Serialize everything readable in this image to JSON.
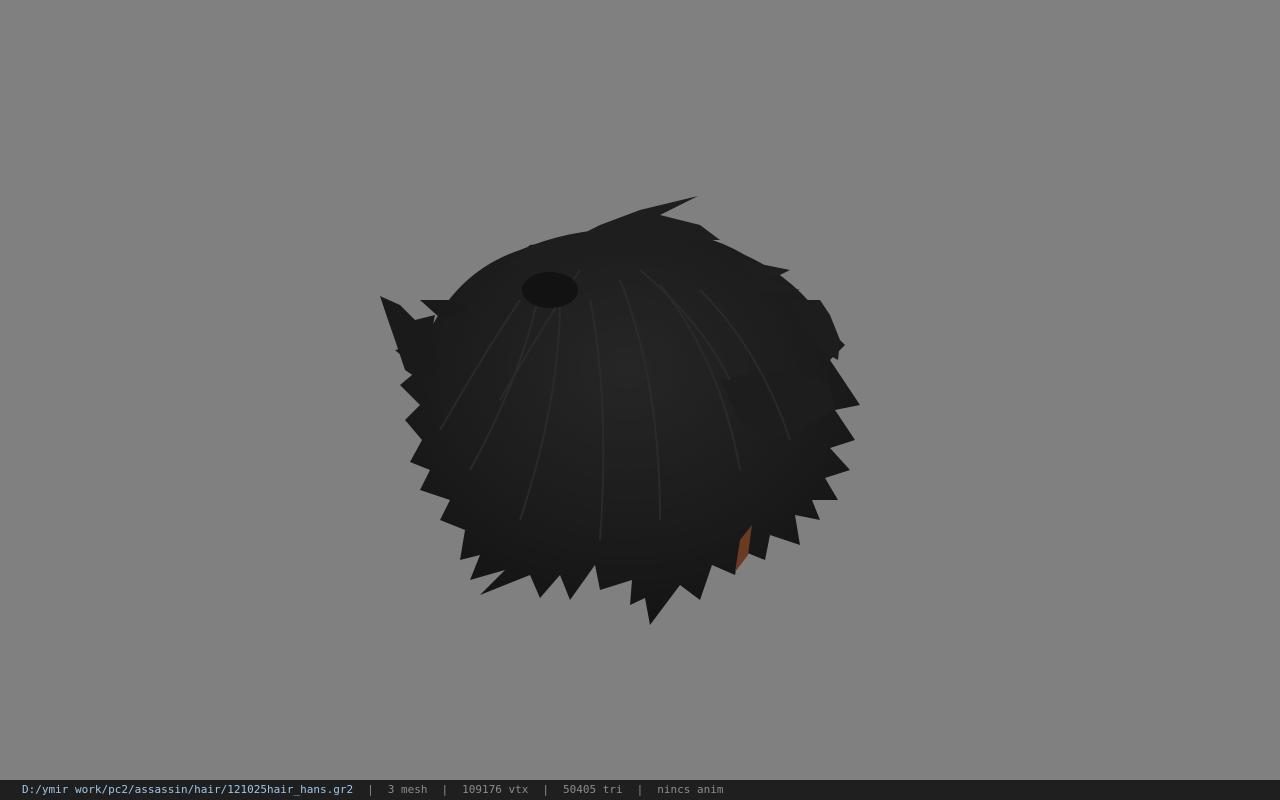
{
  "viewport": {
    "background_color": "#808080",
    "model_color": "#1b1b1b",
    "model_highlight_color": "#2e2e2e",
    "accent_strand_color": "#6b3a22"
  },
  "status_bar": {
    "file_path": "D:/ymir work/pc2/assassin/hair/121025hair_hans.gr2",
    "separator": "|",
    "mesh_count": "3 mesh",
    "vertex_count": "109176 vtx",
    "triangle_count": "50405 tri",
    "animation": "nincs anim"
  }
}
